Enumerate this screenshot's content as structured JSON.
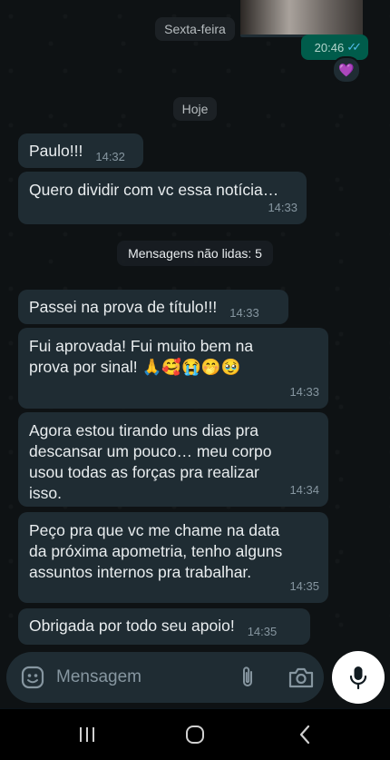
{
  "chat": {
    "date_previous": "Sexta-feira",
    "outgoing_time": "20:46",
    "reaction": "💜",
    "date_today": "Hoje",
    "unread_label": "Mensagens não lidas: 5"
  },
  "messages": [
    {
      "text": "Paulo!!!",
      "time": "14:32"
    },
    {
      "text": "Quero dividir com vc essa notícia…",
      "time": "14:33"
    },
    {
      "text": "Passei na prova de título!!!",
      "time": "14:33"
    },
    {
      "line1": "Fui aprovada! Fui muito bem na",
      "line2": "prova por sinal! 🙏🥰😭🤭🥹",
      "time": "14:33"
    },
    {
      "line1": "Agora estou tirando uns dias pra",
      "line2": "descansar um pouco… meu corpo",
      "line3": "usou todas as forças pra realizar",
      "line4": "isso.",
      "time": "14:34"
    },
    {
      "line1": "Peço pra que vc me chame na data",
      "line2": "da próxima apometria, tenho alguns",
      "line3": "assuntos internos pra trabalhar.",
      "time": "14:35"
    },
    {
      "text": "Obrigada por todo seu apoio!",
      "time": "14:35"
    }
  ],
  "composer": {
    "placeholder": "Mensagem",
    "icons": [
      "emoji-icon",
      "attach-icon",
      "camera-icon",
      "mic-icon"
    ]
  },
  "navbar": {
    "icons": [
      "recent-apps-icon",
      "home-icon",
      "back-icon"
    ]
  },
  "colors": {
    "background": "#0e1214",
    "incoming_bubble": "#1f2c33",
    "outgoing_bubble": "#005c4b",
    "read_ticks": "#53bdeb"
  }
}
